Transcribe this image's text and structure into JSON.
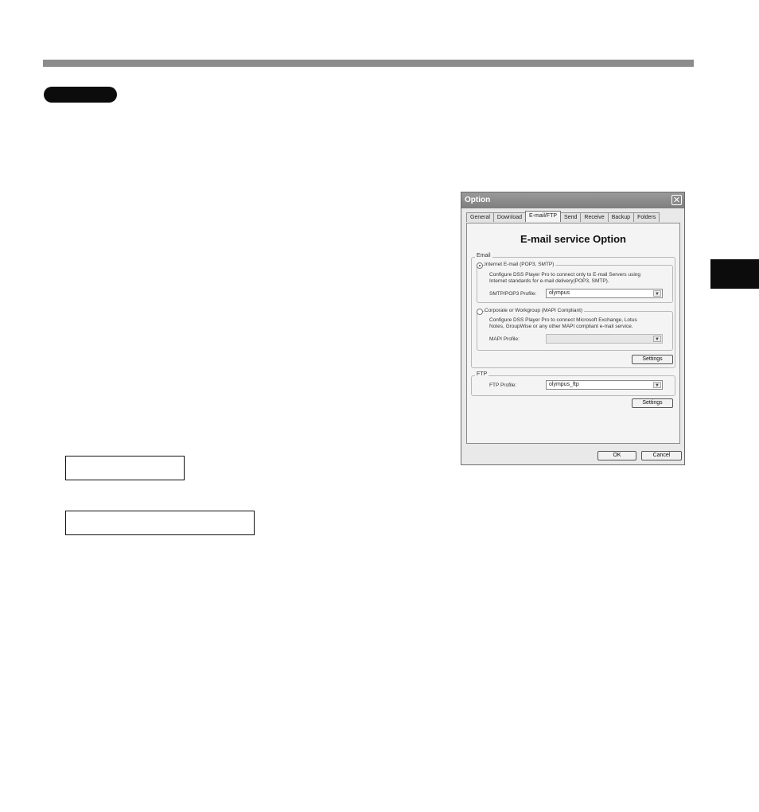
{
  "dialog": {
    "title": "Option",
    "close_glyph": "✕",
    "tabs": [
      {
        "label": "General"
      },
      {
        "label": "Download"
      },
      {
        "label": "E-mail/FTP"
      },
      {
        "label": "Send"
      },
      {
        "label": "Receive"
      },
      {
        "label": "Backup"
      },
      {
        "label": "Folders"
      }
    ],
    "active_tab": "E-mail/FTP",
    "panel_title": "E-mail service Option",
    "email": {
      "group_label": "Email",
      "internet": {
        "label": "Internet E-mail (POP3, SMTP)",
        "selected": true,
        "description_1": "Configure DSS Player Pro to connect only to E-mail Servers using",
        "description_2": "Internet standards for e-mail delivery(POP3, SMTP).",
        "profile_label": "SMTP/POP3 Profile:",
        "profile_value": "olympus"
      },
      "corporate": {
        "label": "Corporate or Workgroup (MAPI Compliant)",
        "selected": false,
        "description_1": "Configure DSS Player Pro to connect Microsoft Exchange, Lotus",
        "description_2": "Notes, GroupWise or any other MAPI compliant e-mail service.",
        "profile_label": "MAPI Profile:",
        "profile_value": ""
      },
      "settings_label": "Settings"
    },
    "ftp": {
      "group_label": "FTP",
      "profile_label": "FTP Profile:",
      "profile_value": "olympus_ftp",
      "settings_label": "Settings"
    },
    "ok_label": "OK",
    "cancel_label": "Cancel",
    "dropdown_arrow": "▼"
  }
}
